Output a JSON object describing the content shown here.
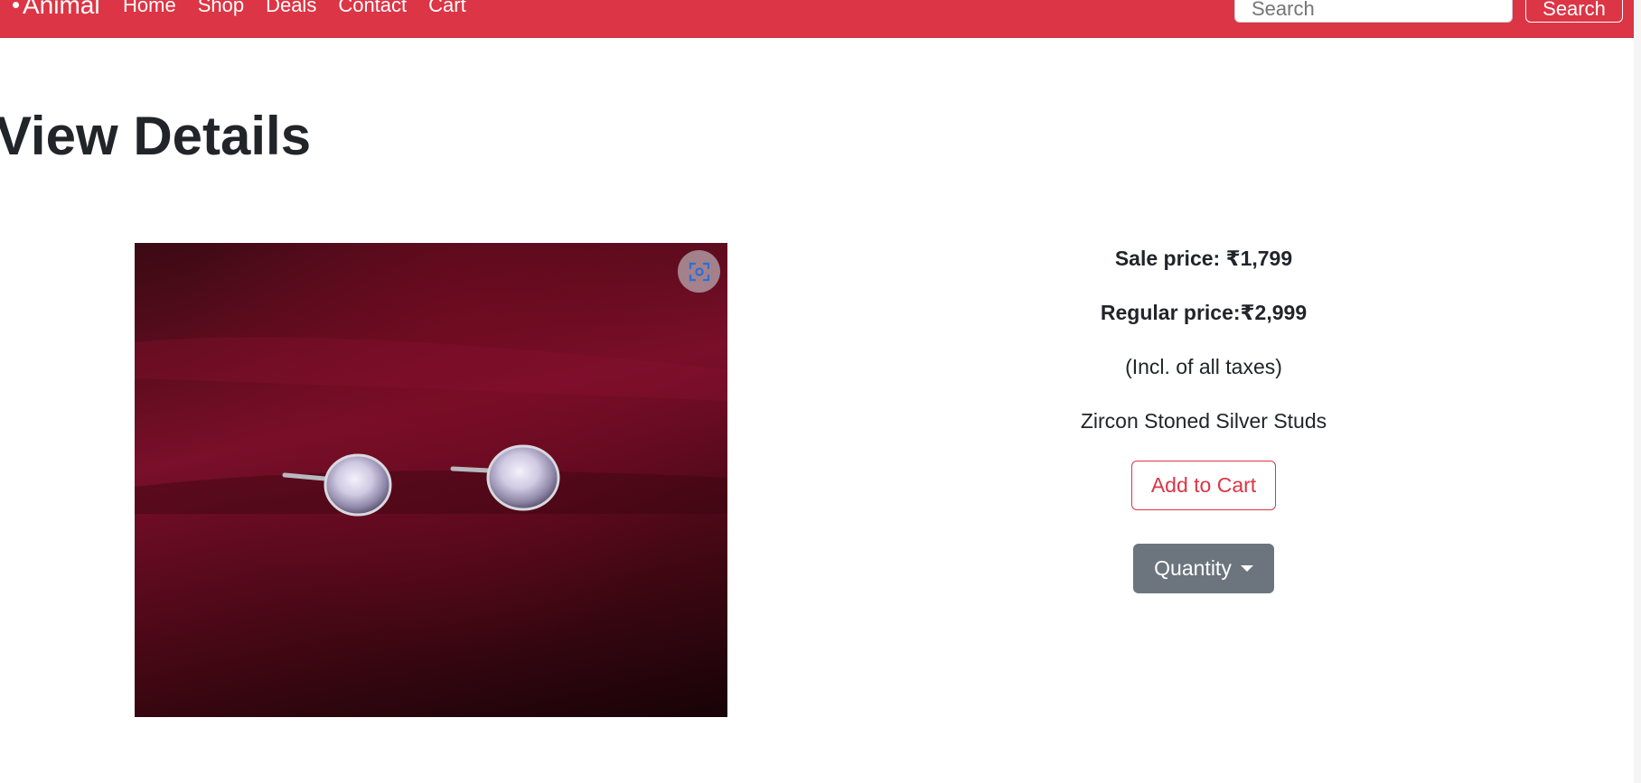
{
  "navbar": {
    "brand": "Animal",
    "links": [
      "Home",
      "Shop",
      "Deals",
      "Contact",
      "Cart"
    ],
    "search_placeholder": "Search",
    "search_button": "Search"
  },
  "page": {
    "title": "View Details"
  },
  "product": {
    "sale_price": "Sale price: ₹1,799",
    "regular_price": "Regular price:₹2,999",
    "tax_note": "(Incl. of all taxes)",
    "name": "Zircon Stoned Silver Studs",
    "add_to_cart": "Add to Cart",
    "quantity_label": "Quantity"
  },
  "colors": {
    "brand": "#dc3545",
    "secondary": "#6c757d",
    "text": "#212529"
  }
}
